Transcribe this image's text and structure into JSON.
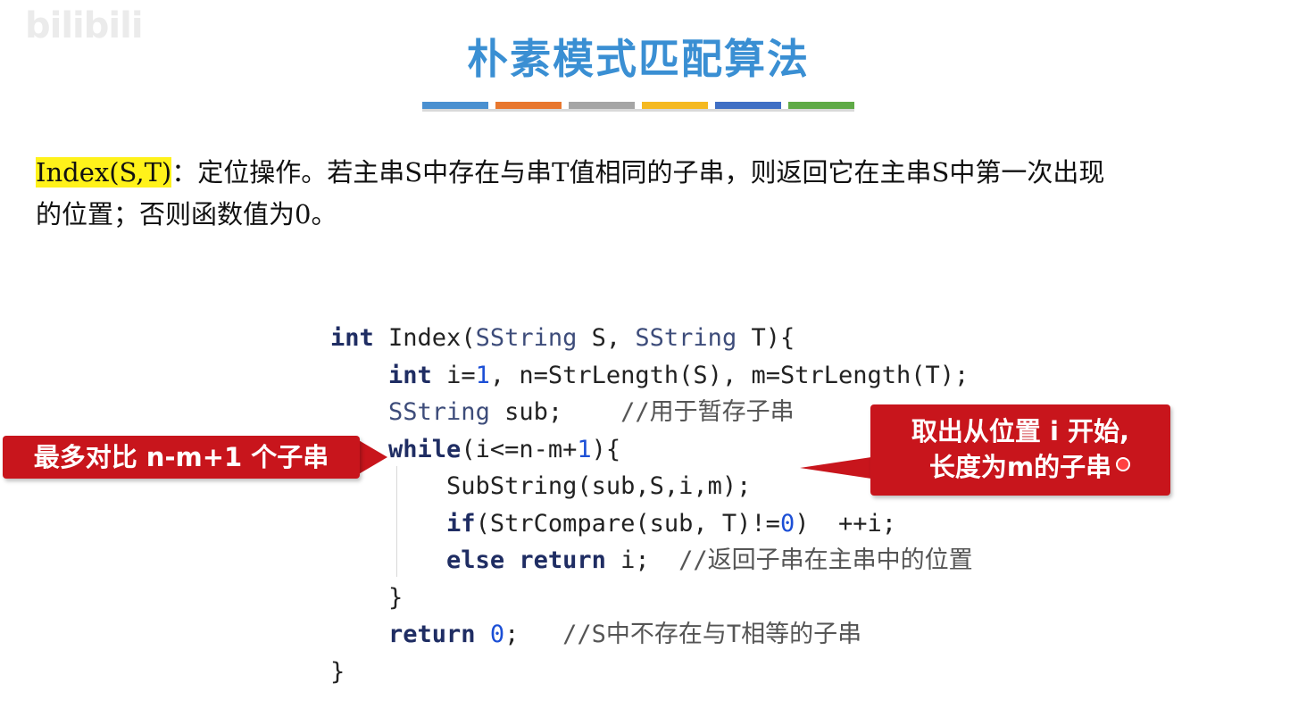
{
  "watermark": "bilibili",
  "title": "朴素模式匹配算法",
  "title_bar_colors": [
    "#4a90d0",
    "#e8772e",
    "#a5a5a5",
    "#f5b921",
    "#3f6fc4",
    "#5faa46"
  ],
  "description": {
    "term": "Index(S,T)",
    "line1": "：定位操作。若主串S中存在与串T值相同的子串，则返回它在主串S中第一次出现",
    "line2": "的位置；否则函数值为0。"
  },
  "code": {
    "l1": {
      "kw": "int",
      "name": " Index(",
      "ty1": "SString",
      "mid": " S, ",
      "ty2": "SString",
      "end": " T){"
    },
    "l2": {
      "indent": "    ",
      "kw": "int",
      "a": " i=",
      "n1": "1",
      "b": ", n=StrLength(S), m=StrLength(T);"
    },
    "l3": {
      "indent": "    ",
      "ty": "SString",
      "a": " sub;    ",
      "comment": "//用于暂存子串"
    },
    "l4": {
      "indent": "    ",
      "kw": "while",
      "a": "(i<=n-m+",
      "n1": "1",
      "b": "){"
    },
    "l5": {
      "indent": "        ",
      "text": "SubString(sub,S,i,m);"
    },
    "l6": {
      "indent": "        ",
      "kw": "if",
      "a": "(StrCompare(sub, T)!=",
      "n0": "0",
      "b": ")  ++i;"
    },
    "l7": {
      "indent": "        ",
      "kw1": "else",
      "sp": " ",
      "kw2": "return",
      "a": " i;  ",
      "comment": "//返回子串在主串中的位置"
    },
    "l8": {
      "indent": "    ",
      "text": "}"
    },
    "l9": {
      "indent": "    ",
      "kw": "return",
      "sp": " ",
      "n0": "0",
      "a": ";   ",
      "comment": "//S中不存在与T相等的子串"
    },
    "l10": {
      "text": "}"
    }
  },
  "callouts": {
    "left": "最多对比 n-m+1 个子串",
    "right_line1": "取出从位置 i 开始,",
    "right_line2": "长度为m的子串"
  },
  "colors": {
    "callout": "#c8151c",
    "title": "#3a8fd3",
    "highlight": "#fff21a"
  }
}
